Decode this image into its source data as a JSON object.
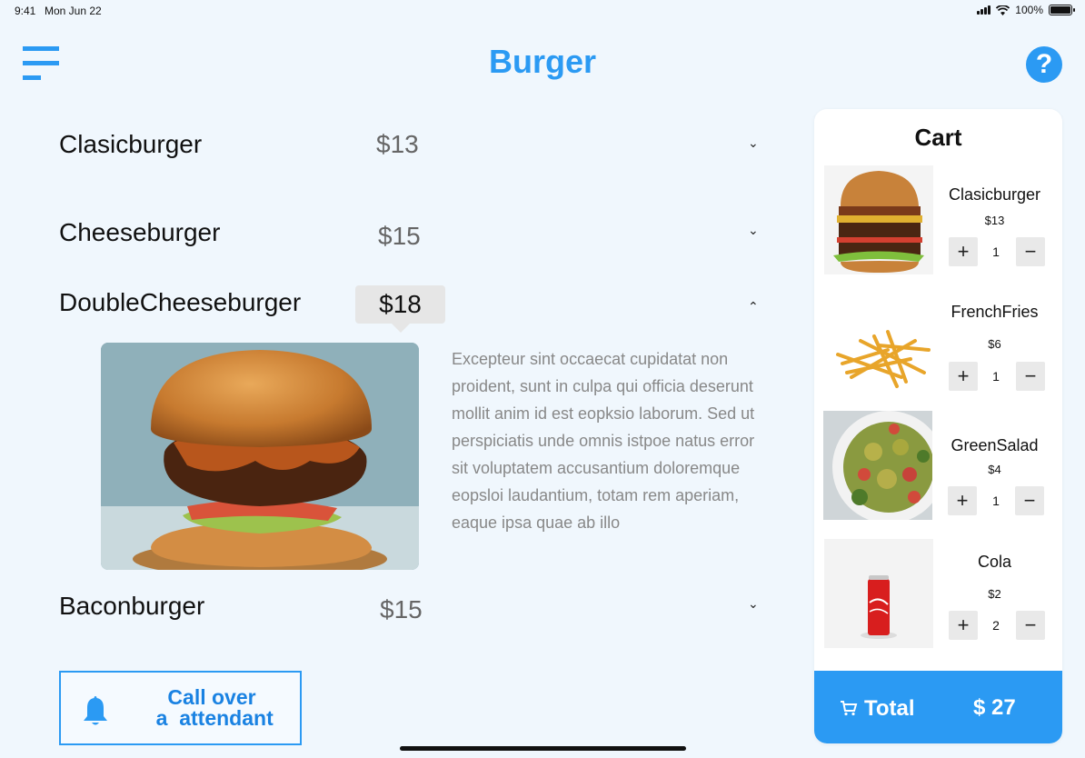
{
  "status": {
    "time": "9:41",
    "date": "Mon Jun 22",
    "battery": "100%"
  },
  "header": {
    "title": "Burger",
    "help_glyph": "?"
  },
  "menu": {
    "items": [
      {
        "name": "Clasicburger",
        "price": "$13",
        "expanded": false
      },
      {
        "name": "Cheeseburger",
        "price": "$15",
        "expanded": false
      },
      {
        "name": "DoubleCheeseburger",
        "price": "$18",
        "expanded": true
      },
      {
        "name": "Baconburger",
        "price": "$15",
        "expanded": false
      }
    ],
    "chevron_down": "⌄",
    "chevron_up": "⌃",
    "description": "Excepteur sint occaecat cupidatat non proident, sunt in culpa qui officia deserunt mollit anim id est eopksio laborum. Sed ut perspiciatis unde omnis istpoe natus error sit voluptatem accusantium doloremque eopsloi laudantium, totam rem aperiam, eaque ipsa quae ab illo"
  },
  "call_button": {
    "label": "Call over\n a  attendant"
  },
  "cart": {
    "title": "Cart",
    "items": [
      {
        "name": "Clasicburger",
        "price": "$13",
        "qty": "1"
      },
      {
        "name": "FrenchFries",
        "price": "$6",
        "qty": "1"
      },
      {
        "name": "GreenSalad",
        "price": "$4",
        "qty": "1"
      },
      {
        "name": "Cola",
        "price": "$2",
        "qty": "2"
      }
    ],
    "plus": "+",
    "minus": "−",
    "total_label": "Total",
    "total_value": "$ 27"
  },
  "colors": {
    "accent": "#2b9af3",
    "background": "#f0f7fd"
  },
  "icons": {
    "menu": "hamburger-menu-icon",
    "help": "question-mark-icon",
    "bell": "bell-icon",
    "cart": "shopping-cart-icon",
    "wifi": "wifi-icon",
    "signal": "cellular-signal-icon",
    "battery": "battery-icon"
  }
}
